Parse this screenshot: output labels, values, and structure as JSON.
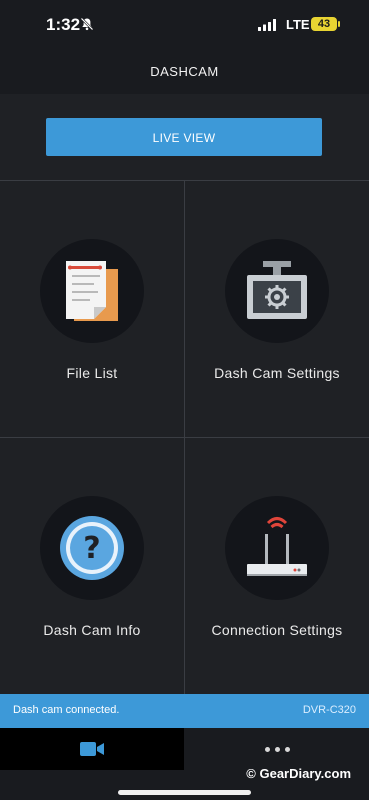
{
  "status_bar": {
    "time": "1:32",
    "network": "LTE",
    "battery": "43"
  },
  "header": {
    "title": "DASHCAM"
  },
  "live_view": {
    "label": "LIVE VIEW"
  },
  "tiles": [
    {
      "label": "File List",
      "icon": "file-list-icon"
    },
    {
      "label": "Dash Cam Settings",
      "icon": "dashcam-settings-icon"
    },
    {
      "label": "Dash Cam Info",
      "icon": "help-icon"
    },
    {
      "label": "Connection Settings",
      "icon": "router-icon"
    }
  ],
  "banner": {
    "status": "Dash cam connected.",
    "model": "DVR-C320"
  },
  "tab_bar": {
    "tabs": [
      {
        "icon": "video-camera-icon",
        "active": true
      },
      {
        "icon": "more-dots-icon",
        "active": false
      }
    ]
  },
  "watermark": "© GearDiary.com",
  "colors": {
    "accent": "#3d99d8",
    "background": "#1f2125",
    "header": "#191b1f"
  }
}
